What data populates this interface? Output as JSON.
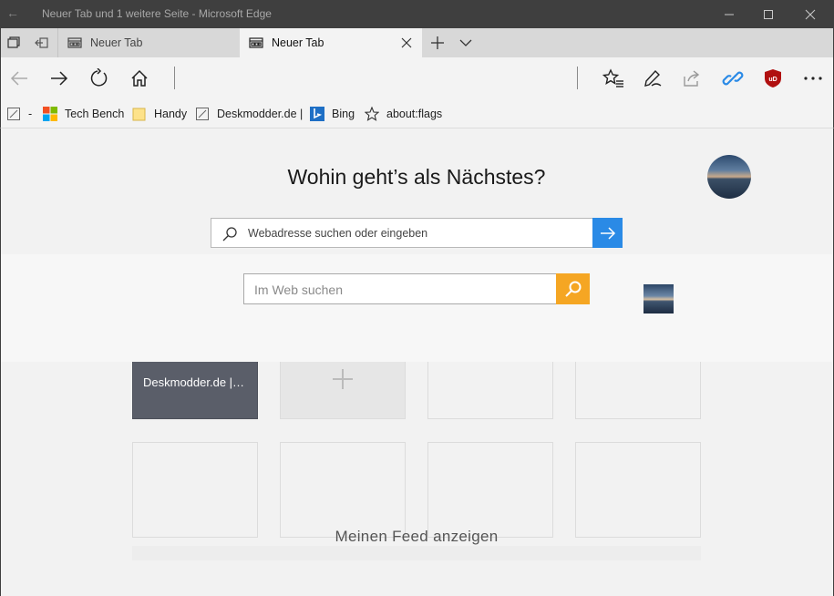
{
  "window": {
    "title": "Neuer Tab und 1 weitere Seite - Microsoft Edge",
    "back_glyph": "←",
    "minimize_label": "Minimieren",
    "maximize_label": "Maximieren",
    "close_label": "Schließen"
  },
  "tabs": [
    {
      "label": "Neuer Tab",
      "active": false
    },
    {
      "label": "Neuer Tab",
      "active": true
    }
  ],
  "favorites": [
    {
      "label": "-",
      "icon": "pen-page-icon"
    },
    {
      "label": "Tech Bench",
      "icon": "windows-logo-icon"
    },
    {
      "label": "Handy",
      "icon": "folder-icon"
    },
    {
      "label": "Deskmodder.de |",
      "icon": "pen-page-icon"
    },
    {
      "label": "Bing",
      "icon": "bing-icon"
    },
    {
      "label": "about:flags",
      "icon": "star-icon"
    }
  ],
  "newtab": {
    "heading": "Wohin geht’s als Nächstes?",
    "url_placeholder": "Webadresse suchen oder eingeben",
    "web_search_placeholder": "Im Web suchen",
    "feed_link": "Meinen Feed anzeigen"
  },
  "top_sites": [
    {
      "label": "Deskmodder.de |…",
      "kind": "site"
    },
    {
      "label": "",
      "kind": "add"
    },
    {
      "label": "",
      "kind": "empty"
    },
    {
      "label": "",
      "kind": "empty"
    },
    {
      "label": "",
      "kind": "empty"
    },
    {
      "label": "",
      "kind": "empty"
    },
    {
      "label": "",
      "kind": "empty"
    },
    {
      "label": "",
      "kind": "empty"
    }
  ],
  "colors": {
    "titlebar": "#3f3f3f",
    "accent_blue": "#2a8ae6",
    "search_orange": "#f5a623",
    "ublock_red": "#b00f0f"
  }
}
